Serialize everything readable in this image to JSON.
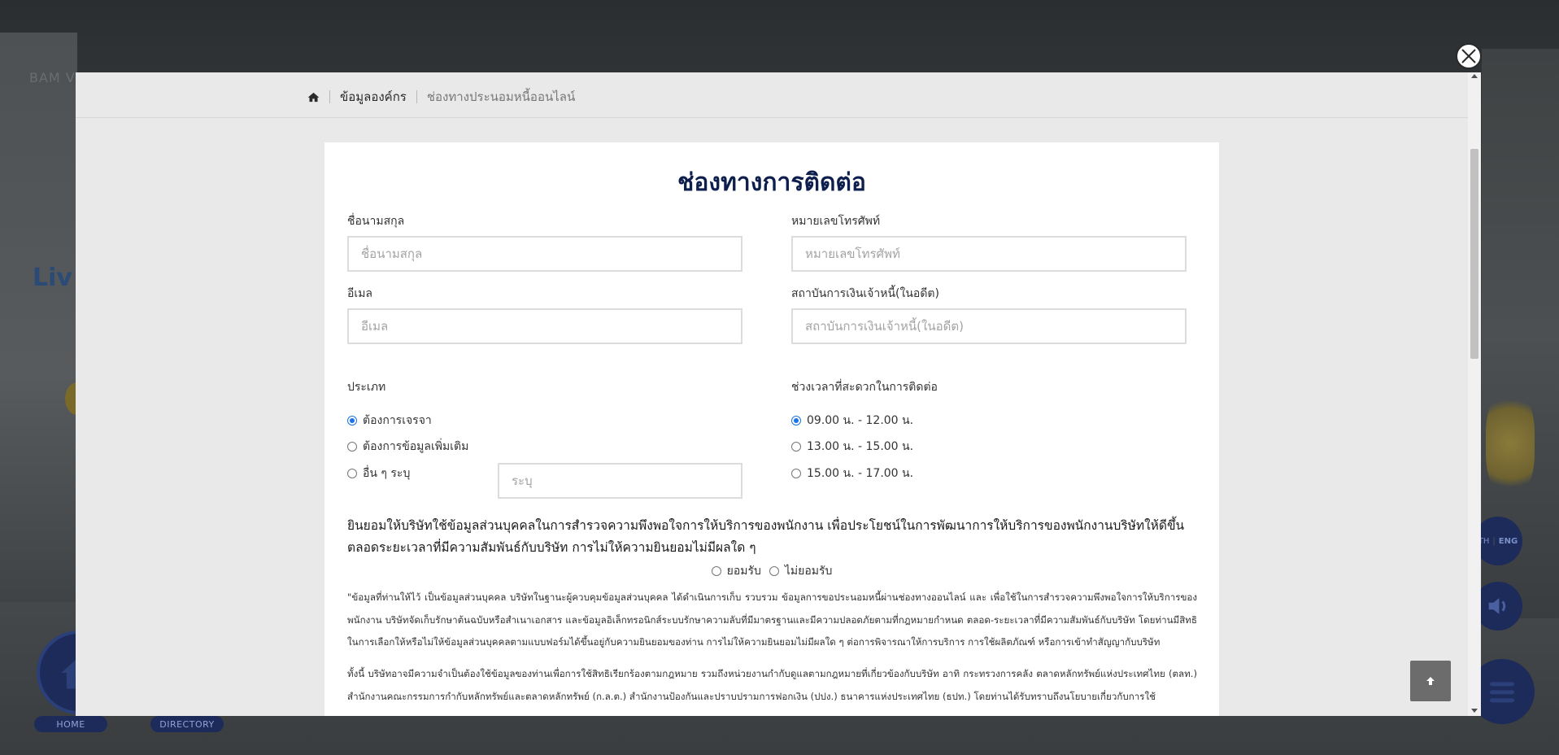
{
  "background": {
    "logo_text": "BAM V",
    "live_text": "Liv",
    "home_label": "HOME",
    "directory_label": "DIRECTORY",
    "lang_th": "TH",
    "lang_en": "ENG"
  },
  "breadcrumb": {
    "home_icon": "home-icon",
    "items": [
      "ข้อมูลองค์กร",
      "ช่องทางประนอมหนี้ออนไลน์"
    ]
  },
  "form": {
    "title": "ช่องทางการติดต่อ",
    "name": {
      "label": "ชื่อนามสกุล",
      "placeholder": "ชื่อนามสกุล",
      "value": ""
    },
    "phone": {
      "label": "หมายเลขโทรศัพท์",
      "placeholder": "หมายเลขโทรศัพท์",
      "value": ""
    },
    "email": {
      "label": "อีเมล",
      "placeholder": "อีเมล",
      "value": ""
    },
    "creditor": {
      "label": "สถาบันการเงินเจ้าหนี้(ในอดีต)",
      "placeholder": "สถาบันการเงินเจ้าหนี้(ในอดีต)",
      "value": ""
    },
    "type": {
      "label": "ประเภท",
      "options": [
        "ต้องการเจรจา",
        "ต้องการข้อมูลเพิ่มเติม",
        "อื่น ๆ ระบุ"
      ],
      "selected": 0,
      "other_placeholder": "ระบุ"
    },
    "contact_time": {
      "label": "ช่วงเวลาที่สะดวกในการติดต่อ",
      "options": [
        "09.00 น. - 12.00 น.",
        "13.00 น. - 15.00 น.",
        "15.00 น. - 17.00 น."
      ],
      "selected": 0
    },
    "consent": {
      "question": "ยินยอมให้บริษัทใช้ข้อมูลส่วนบุคคลในการสำรวจความพึงพอใจการให้บริการของพนักงาน เพื่อประโยชน์ในการพัฒนาการให้บริการของพนักงานบริษัทให้ดีขึ้น ตลอดระยะเวลาที่มีความสัมพันธ์กับบริษัท การไม่ให้ความยินยอมไม่มีผลใด ๆ",
      "accept": "ยอมรับ",
      "decline": "ไม่ยอมรับ"
    },
    "policy_1": "\"ข้อมูลที่ท่านให้ไว้ เป็นข้อมูลส่วนบุคคล บริษัทในฐานะผู้ควบคุมข้อมูลส่วนบุคคล ได้ดำเนินการเก็บ รวบรวม ข้อมูลการขอประนอมหนี้ผ่านช่องทางออนไลน์ และ เพื่อใช้ในการสำรวจความพึงพอใจการให้บริการของพนักงาน บริษัทจัดเก็บรักษาต้นฉบับหรือสำเนาเอกสาร และข้อมูลอิเล็กทรอนิกส์ระบบรักษาความลับที่มีมาตรฐานและมีความปลอดภัยตามที่กฎหมายกำหนด ตลอด-ระยะเวลาที่มีความสัมพันธ์กับบริษัท โดยท่านมีสิทธิในการเลือกให้หรือไม่ให้ข้อมูลส่วนบุคคลตามแบบฟอร์มได้ขึ้นอยู่กับความยินยอมของท่าน การไม่ให้ความยินยอมไม่มีผลใด ๆ ต่อการพิจารณาให้การบริการ การใช้ผลิตภัณฑ์ หรือการเข้าทำสัญญากับบริษัท",
    "policy_2": "ทั้งนี้ บริษัทอาจมีความจำเป็นต้องใช้ข้อมูลของท่านเพื่อการใช้สิทธิเรียกร้องตามกฎหมาย รวมถึงหน่วยงานกำกับดูแลตามกฎหมายที่เกี่ยวข้องกับบริษัท อาทิ กระทรวงการคลัง ตลาดหลักทรัพย์แห่งประเทศไทย (ตลท.) สำนักงานคณะกรรมการกำกับหลักทรัพย์และตลาดหลักทรัพย์ (ก.ล.ต.) สำนักงานป้องกันและปราบปรามการฟอกเงิน (ปปง.) ธนาคารแห่งประเทศไทย (ธปท.) โดยท่านได้รับทราบถึงนโยบายเกี่ยวกับการใช้"
  },
  "colors": {
    "title": "#0e1f4d",
    "radio_checked": "#1a73e8",
    "top_button": "#6c6c6c"
  },
  "icons": {
    "close": "close-icon",
    "scroll_top": "arrow-up-icon"
  }
}
